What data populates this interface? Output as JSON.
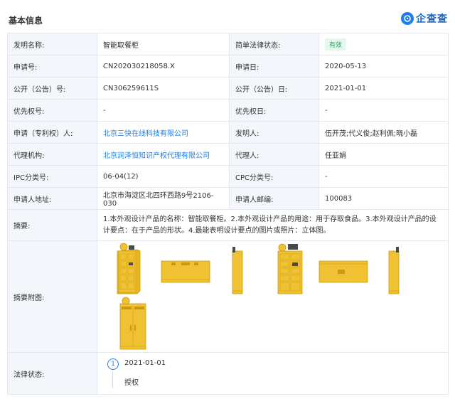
{
  "header": {
    "section_title": "基本信息",
    "logo_text": "企查查",
    "logo_icon": "qichacha-logo-icon"
  },
  "rows": [
    {
      "l1": "发明名称:",
      "v1": "智能取餐柜",
      "l2": "简单法律状态:",
      "v2": "有效"
    },
    {
      "l1": "申请号:",
      "v1": "CN202030218058.X",
      "l2": "申请日:",
      "v2": "2020-05-13"
    },
    {
      "l1": "公开（公告）号:",
      "v1": "CN306259611S",
      "l2": "公开（公告）日:",
      "v2": "2021-01-01"
    },
    {
      "l1": "优先权号:",
      "v1": "-",
      "l2": "优先权日:",
      "v2": "-"
    },
    {
      "l1": "申请（专利权）人:",
      "v1": "北京三快在线科技有限公司",
      "l2": "发明人:",
      "v2": "伍开茂;代义俊;赵利佩;晓小磊"
    },
    {
      "l1": "代理机构:",
      "v1": "北京润泽恒知识产权代理有限公司",
      "l2": "代理人:",
      "v2": "任亚娟"
    },
    {
      "l1": "IPC分类号:",
      "v1": "06-04(12)",
      "l2": "CPC分类号:",
      "v2": "-"
    },
    {
      "l1": "申请人地址:",
      "v1": "北京市海淀区北四环西路9号2106-030",
      "l2": "申请人邮编:",
      "v2": "100083"
    }
  ],
  "abstract": {
    "label": "摘要:",
    "text": "1.本外观设计产品的名称：智能取餐柜。2.本外观设计产品的用途：用于存取食品。3.本外观设计产品的设计要点：在于产品的形状。4.最能表明设计要点的图片或照片：立体图。"
  },
  "images": {
    "label": "摘要附图:",
    "colors": {
      "body": "#f0c233",
      "edge": "#c99a12",
      "door": "#e9b623",
      "screen": "#4a4a4a"
    }
  },
  "legal": {
    "label": "法律状态:",
    "step": "1",
    "date": "2021-01-01",
    "status": "授权"
  },
  "colors": {
    "accent": "#1a7ff0",
    "badge_green": "#1db25b",
    "label_bg": "#f3f6fa"
  }
}
